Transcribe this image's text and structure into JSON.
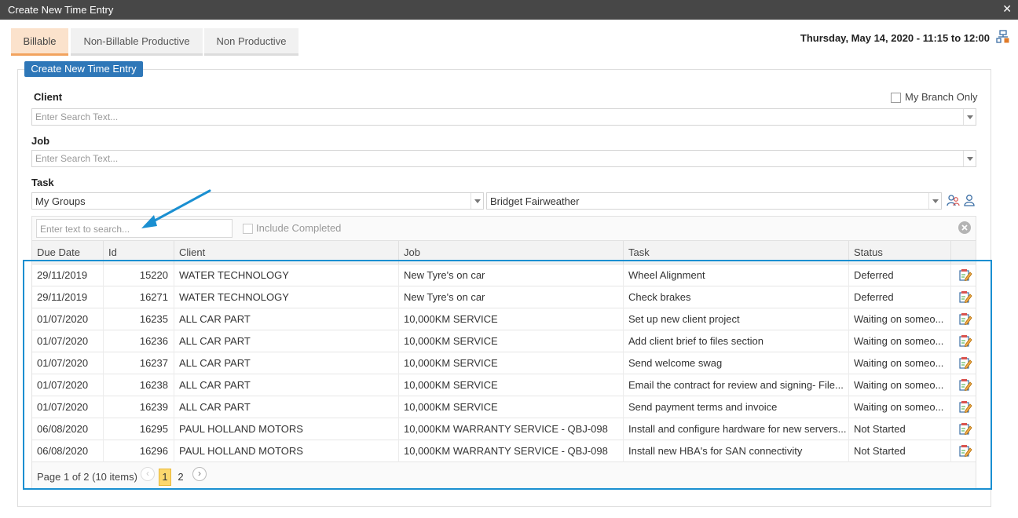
{
  "window": {
    "title": "Create New Time Entry",
    "close_icon": "close-icon"
  },
  "tabs": [
    {
      "label": "Billable",
      "active": true
    },
    {
      "label": "Non-Billable Productive",
      "active": false
    },
    {
      "label": "Non Productive",
      "active": false
    }
  ],
  "datetime": "Thursday, May 14, 2020 - 11:15 to 12:00",
  "create_button": "Create New Time Entry",
  "form": {
    "client_label": "Client",
    "client_placeholder": "Enter Search Text...",
    "my_branch_only": "My Branch Only",
    "job_label": "Job",
    "job_placeholder": "Enter Search Text...",
    "task_label": "Task",
    "group_value": "My Groups",
    "person_value": "Bridget Fairweather"
  },
  "grid_toolbar": {
    "search_placeholder": "Enter text to search...",
    "include_completed": "Include Completed"
  },
  "columns": [
    "Due Date",
    "Id",
    "Client",
    "Job",
    "Task",
    "Status"
  ],
  "rows": [
    [
      "29/11/2019",
      "15220",
      "WATER TECHNOLOGY",
      "New Tyre's on car",
      "Wheel Alignment",
      "Deferred"
    ],
    [
      "29/11/2019",
      "16271",
      "WATER TECHNOLOGY",
      "New Tyre's on car",
      "Check brakes",
      "Deferred"
    ],
    [
      "01/07/2020",
      "16235",
      "ALL CAR PART",
      "10,000KM SERVICE",
      "Set up new client project",
      "Waiting on someo..."
    ],
    [
      "01/07/2020",
      "16236",
      "ALL CAR PART",
      "10,000KM SERVICE",
      "Add client brief to files section",
      "Waiting on someo..."
    ],
    [
      "01/07/2020",
      "16237",
      "ALL CAR PART",
      "10,000KM SERVICE",
      "Send welcome swag",
      "Waiting on someo..."
    ],
    [
      "01/07/2020",
      "16238",
      "ALL CAR PART",
      "10,000KM SERVICE",
      "Email the contract for review and signing- File...",
      "Waiting on someo..."
    ],
    [
      "01/07/2020",
      "16239",
      "ALL CAR PART",
      "10,000KM SERVICE",
      "Send payment terms and invoice",
      "Waiting on someo..."
    ],
    [
      "06/08/2020",
      "16295",
      "PAUL HOLLAND MOTORS",
      "10,000KM WARRANTY SERVICE - QBJ-098",
      "Install and configure hardware for new servers...",
      "Not Started"
    ],
    [
      "06/08/2020",
      "16296",
      "PAUL HOLLAND MOTORS",
      "10,000KM WARRANTY SERVICE - QBJ-098",
      "Install new HBA's for SAN connectivity",
      "Not Started"
    ]
  ],
  "pager": {
    "info": "Page 1 of 2 (10 items)",
    "pages": [
      "1",
      "2"
    ],
    "current": "1"
  },
  "colors": {
    "accent": "#2e77b8",
    "highlight": "#1a8fd1",
    "active_tab": "#fbe2cc"
  }
}
